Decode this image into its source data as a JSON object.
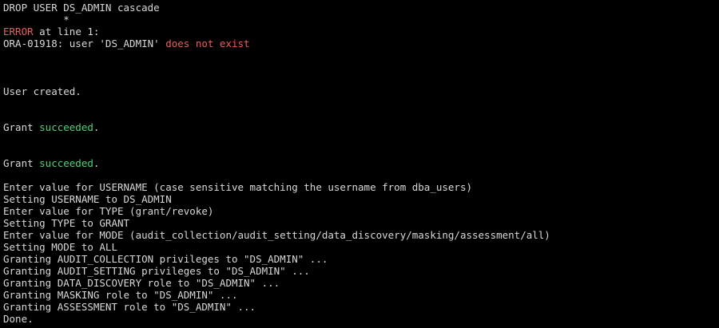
{
  "terminal": {
    "colors": {
      "background": "#000000",
      "text": "#d8d8d8",
      "error": "#ec5c5c",
      "success": "#4fd17b"
    },
    "lines": [
      [
        {
          "text": "DROP USER DS_ADMIN cascade"
        }
      ],
      [
        {
          "text": "          *"
        }
      ],
      [
        {
          "text": "ERROR",
          "style": "err"
        },
        {
          "text": " at line 1:"
        }
      ],
      [
        {
          "text": "ORA-01918: user 'DS_ADMIN' "
        },
        {
          "text": "does not exist",
          "style": "err"
        }
      ],
      [],
      [],
      [],
      [
        {
          "text": "User created."
        }
      ],
      [],
      [],
      [
        {
          "text": "Grant "
        },
        {
          "text": "succeeded",
          "style": "ok"
        },
        {
          "text": "."
        }
      ],
      [],
      [],
      [
        {
          "text": "Grant "
        },
        {
          "text": "succeeded",
          "style": "ok"
        },
        {
          "text": "."
        }
      ],
      [],
      [
        {
          "text": "Enter value for USERNAME (case sensitive matching the username from dba_users)"
        }
      ],
      [
        {
          "text": "Setting USERNAME to DS_ADMIN"
        }
      ],
      [
        {
          "text": "Enter value for TYPE (grant/revoke)"
        }
      ],
      [
        {
          "text": "Setting TYPE to GRANT"
        }
      ],
      [
        {
          "text": "Enter value for MODE (audit_collection/audit_setting/data_discovery/masking/assessment/all)"
        }
      ],
      [
        {
          "text": "Setting MODE to ALL"
        }
      ],
      [
        {
          "text": "Granting AUDIT_COLLECTION privileges to \"DS_ADMIN\" ..."
        }
      ],
      [
        {
          "text": "Granting AUDIT_SETTING privileges to \"DS_ADMIN\" ..."
        }
      ],
      [
        {
          "text": "Granting DATA_DISCOVERY role to \"DS_ADMIN\" ..."
        }
      ],
      [
        {
          "text": "Granting MASKING role to \"DS_ADMIN\" ..."
        }
      ],
      [
        {
          "text": "Granting ASSESSMENT role to \"DS_ADMIN\" ..."
        }
      ],
      [
        {
          "text": "Done."
        }
      ]
    ]
  }
}
